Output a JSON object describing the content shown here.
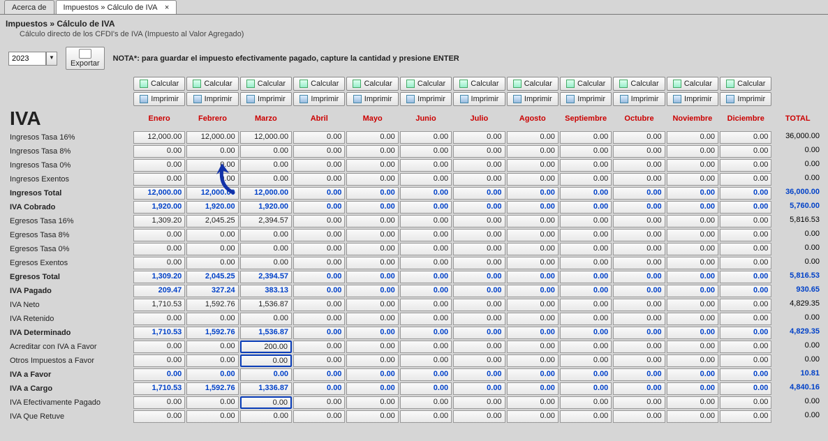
{
  "tabs": {
    "inactive": "Acerca de",
    "active": "Impuestos » Cálculo de IVA",
    "close": "×"
  },
  "breadcrumb": {
    "title": "Impuestos » Cálculo de IVA",
    "subtitle": "Cálculo directo de los CFDI's de IVA (Impuesto al Valor Agregado)"
  },
  "toolbar": {
    "year": "2023",
    "export_label": "Exportar",
    "note": "NOTA*: para guardar el impuesto efectivamente pagado, capture la cantidad y presione ENTER"
  },
  "buttons": {
    "calcular": "Calcular",
    "imprimir": "Imprimir"
  },
  "title": "IVA",
  "months": [
    "Enero",
    "Febrero",
    "Marzo",
    "Abril",
    "Mayo",
    "Junio",
    "Julio",
    "Agosto",
    "Septiembre",
    "Octubre",
    "Noviembre",
    "Diciembre"
  ],
  "total_label": "TOTAL",
  "rows": [
    {
      "label": "Ingresos Tasa 16%",
      "bold": false,
      "blue": false,
      "vals": [
        "12,000.00",
        "12,000.00",
        "12,000.00",
        "0.00",
        "0.00",
        "0.00",
        "0.00",
        "0.00",
        "0.00",
        "0.00",
        "0.00",
        "0.00"
      ],
      "total": "36,000.00"
    },
    {
      "label": "Ingresos Tasa 8%",
      "bold": false,
      "blue": false,
      "vals": [
        "0.00",
        "0.00",
        "0.00",
        "0.00",
        "0.00",
        "0.00",
        "0.00",
        "0.00",
        "0.00",
        "0.00",
        "0.00",
        "0.00"
      ],
      "total": "0.00"
    },
    {
      "label": "Ingresos Tasa 0%",
      "bold": false,
      "blue": false,
      "vals": [
        "0.00",
        "0.00",
        "0.00",
        "0.00",
        "0.00",
        "0.00",
        "0.00",
        "0.00",
        "0.00",
        "0.00",
        "0.00",
        "0.00"
      ],
      "total": "0.00"
    },
    {
      "label": "Ingresos Exentos",
      "bold": false,
      "blue": false,
      "vals": [
        "0.00",
        "0.00",
        "0.00",
        "0.00",
        "0.00",
        "0.00",
        "0.00",
        "0.00",
        "0.00",
        "0.00",
        "0.00",
        "0.00"
      ],
      "total": "0.00"
    },
    {
      "label": "Ingresos Total",
      "bold": true,
      "blue": true,
      "vals": [
        "12,000.00",
        "12,000.00",
        "12,000.00",
        "0.00",
        "0.00",
        "0.00",
        "0.00",
        "0.00",
        "0.00",
        "0.00",
        "0.00",
        "0.00"
      ],
      "total": "36,000.00"
    },
    {
      "label": "IVA Cobrado",
      "bold": true,
      "blue": true,
      "vals": [
        "1,920.00",
        "1,920.00",
        "1,920.00",
        "0.00",
        "0.00",
        "0.00",
        "0.00",
        "0.00",
        "0.00",
        "0.00",
        "0.00",
        "0.00"
      ],
      "total": "5,760.00"
    },
    {
      "label": "Egresos Tasa 16%",
      "bold": false,
      "blue": false,
      "vals": [
        "1,309.20",
        "2,045.25",
        "2,394.57",
        "0.00",
        "0.00",
        "0.00",
        "0.00",
        "0.00",
        "0.00",
        "0.00",
        "0.00",
        "0.00"
      ],
      "total": "5,816.53"
    },
    {
      "label": "Egresos Tasa 8%",
      "bold": false,
      "blue": false,
      "vals": [
        "0.00",
        "0.00",
        "0.00",
        "0.00",
        "0.00",
        "0.00",
        "0.00",
        "0.00",
        "0.00",
        "0.00",
        "0.00",
        "0.00"
      ],
      "total": "0.00"
    },
    {
      "label": "Egresos Tasa 0%",
      "bold": false,
      "blue": false,
      "vals": [
        "0.00",
        "0.00",
        "0.00",
        "0.00",
        "0.00",
        "0.00",
        "0.00",
        "0.00",
        "0.00",
        "0.00",
        "0.00",
        "0.00"
      ],
      "total": "0.00"
    },
    {
      "label": "Egresos Exentos",
      "bold": false,
      "blue": false,
      "vals": [
        "0.00",
        "0.00",
        "0.00",
        "0.00",
        "0.00",
        "0.00",
        "0.00",
        "0.00",
        "0.00",
        "0.00",
        "0.00",
        "0.00"
      ],
      "total": "0.00"
    },
    {
      "label": "Egresos Total",
      "bold": true,
      "blue": true,
      "vals": [
        "1,309.20",
        "2,045.25",
        "2,394.57",
        "0.00",
        "0.00",
        "0.00",
        "0.00",
        "0.00",
        "0.00",
        "0.00",
        "0.00",
        "0.00"
      ],
      "total": "5,816.53"
    },
    {
      "label": "IVA Pagado",
      "bold": true,
      "blue": true,
      "vals": [
        "209.47",
        "327.24",
        "383.13",
        "0.00",
        "0.00",
        "0.00",
        "0.00",
        "0.00",
        "0.00",
        "0.00",
        "0.00",
        "0.00"
      ],
      "total": "930.65"
    },
    {
      "label": "IVA Neto",
      "bold": false,
      "blue": false,
      "vals": [
        "1,710.53",
        "1,592.76",
        "1,536.87",
        "0.00",
        "0.00",
        "0.00",
        "0.00",
        "0.00",
        "0.00",
        "0.00",
        "0.00",
        "0.00"
      ],
      "total": "4,829.35"
    },
    {
      "label": "IVA Retenido",
      "bold": false,
      "blue": false,
      "vals": [
        "0.00",
        "0.00",
        "0.00",
        "0.00",
        "0.00",
        "0.00",
        "0.00",
        "0.00",
        "0.00",
        "0.00",
        "0.00",
        "0.00"
      ],
      "total": "0.00"
    },
    {
      "label": "IVA Determinado",
      "bold": true,
      "blue": true,
      "vals": [
        "1,710.53",
        "1,592.76",
        "1,536.87",
        "0.00",
        "0.00",
        "0.00",
        "0.00",
        "0.00",
        "0.00",
        "0.00",
        "0.00",
        "0.00"
      ],
      "total": "4,829.35"
    },
    {
      "label": "Acreditar con IVA a Favor",
      "bold": false,
      "blue": false,
      "vals": [
        "0.00",
        "0.00",
        "200.00",
        "0.00",
        "0.00",
        "0.00",
        "0.00",
        "0.00",
        "0.00",
        "0.00",
        "0.00",
        "0.00"
      ],
      "total": "0.00"
    },
    {
      "label": "Otros Impuestos a Favor",
      "bold": false,
      "blue": false,
      "vals": [
        "0.00",
        "0.00",
        "0.00",
        "0.00",
        "0.00",
        "0.00",
        "0.00",
        "0.00",
        "0.00",
        "0.00",
        "0.00",
        "0.00"
      ],
      "total": "0.00"
    },
    {
      "label": "IVA a Favor",
      "bold": true,
      "blue": true,
      "vals": [
        "0.00",
        "0.00",
        "0.00",
        "0.00",
        "0.00",
        "0.00",
        "0.00",
        "0.00",
        "0.00",
        "0.00",
        "0.00",
        "0.00"
      ],
      "total": "10.81"
    },
    {
      "label": "IVA a Cargo",
      "bold": true,
      "blue": true,
      "vals": [
        "1,710.53",
        "1,592.76",
        "1,336.87",
        "0.00",
        "0.00",
        "0.00",
        "0.00",
        "0.00",
        "0.00",
        "0.00",
        "0.00",
        "0.00"
      ],
      "total": "4,840.16"
    },
    {
      "label": "IVA Efectivamente Pagado",
      "bold": false,
      "blue": false,
      "vals": [
        "0.00",
        "0.00",
        "0.00",
        "0.00",
        "0.00",
        "0.00",
        "0.00",
        "0.00",
        "0.00",
        "0.00",
        "0.00",
        "0.00"
      ],
      "total": "0.00"
    },
    {
      "label": "IVA Que Retuve",
      "bold": false,
      "blue": false,
      "vals": [
        "0.00",
        "0.00",
        "0.00",
        "0.00",
        "0.00",
        "0.00",
        "0.00",
        "0.00",
        "0.00",
        "0.00",
        "0.00",
        "0.00"
      ],
      "total": "0.00"
    }
  ],
  "highlight_cells": [
    {
      "row": 15,
      "col": 2
    },
    {
      "row": 16,
      "col": 2
    },
    {
      "row": 19,
      "col": 2
    }
  ]
}
